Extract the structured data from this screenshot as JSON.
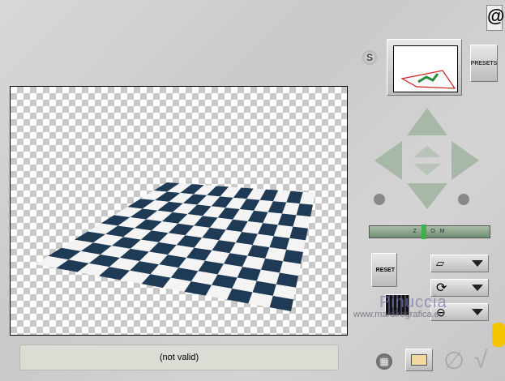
{
  "status": {
    "text": "(not valid)"
  },
  "buttons": {
    "presets": "PRESETS",
    "reset": "RESET",
    "s": "S",
    "zoom": "Z O O M"
  },
  "watermark": {
    "name": "Pinuccia",
    "url": "www.mardiregrafica.eu"
  },
  "colors": {
    "tile_dark": "#1e3a55",
    "tile_light": "#f4f4f4",
    "zoom_slider": "#3fae4f",
    "preview_border": "#d02020"
  },
  "zoom_level": 0.45
}
